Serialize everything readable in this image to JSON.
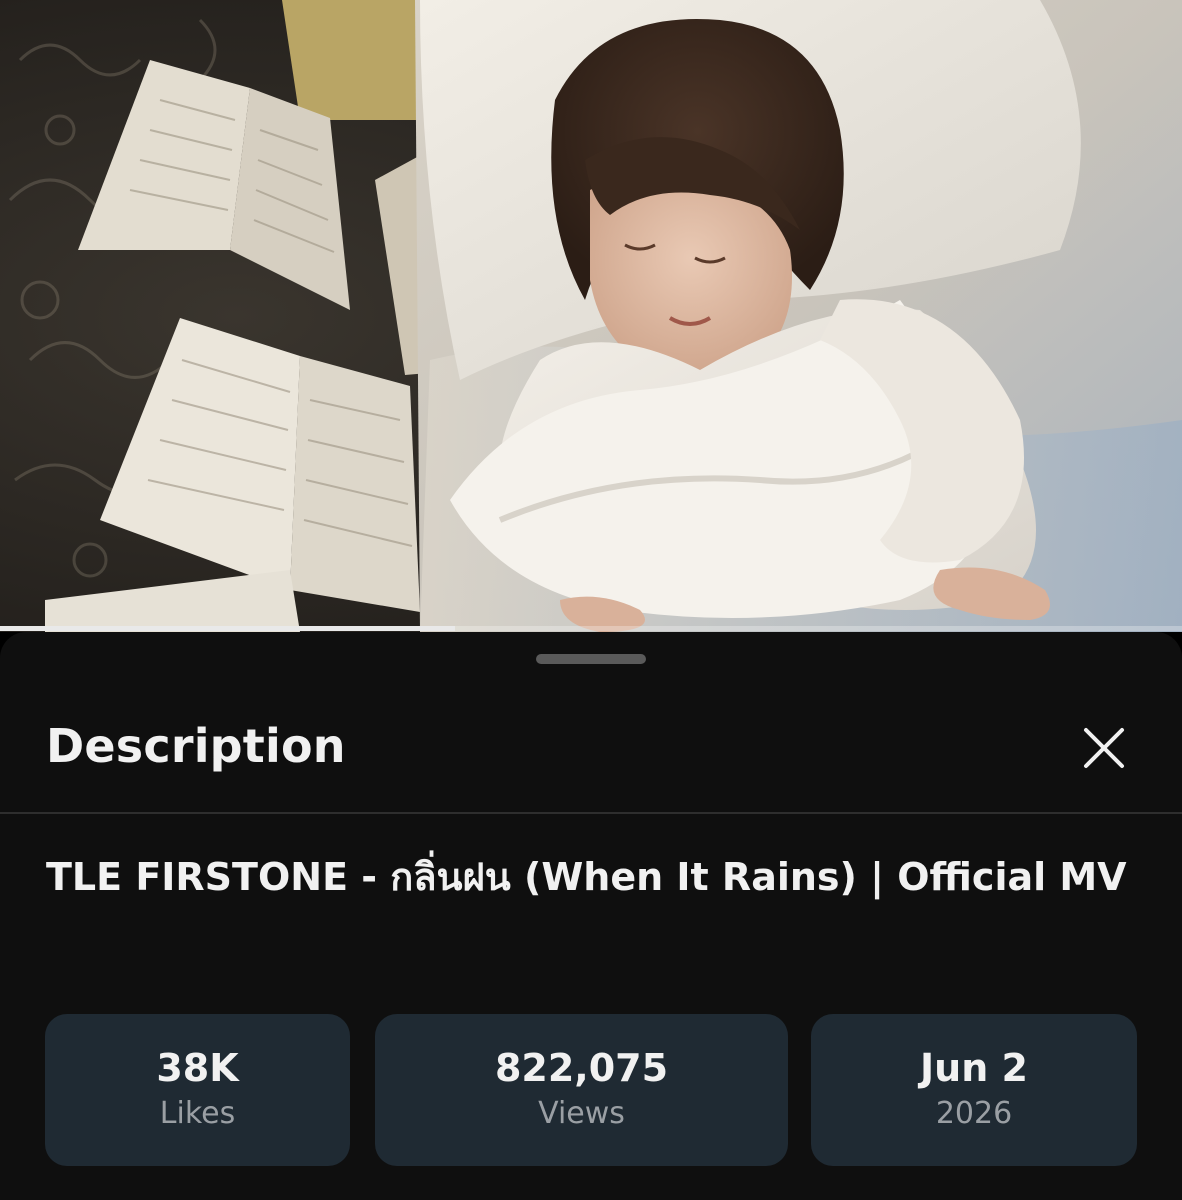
{
  "video": {
    "progress_fraction": 0.385
  },
  "sheet": {
    "title": "Description",
    "close_icon": "close-icon"
  },
  "video_info": {
    "title": "TLE FIRSTONE - กลิ่นฝน (When It Rains) | Official MV"
  },
  "stats": {
    "likes": {
      "value": "38K",
      "label": "Likes"
    },
    "views": {
      "value": "822,075",
      "label": "Views"
    },
    "date": {
      "value": "Jun 2",
      "label": "2026"
    }
  },
  "colors": {
    "sheet_background": "#0f0f0f",
    "stat_card": "#1f2a33",
    "primary_text": "#f1f1f1",
    "secondary_text": "#9a9fa4"
  }
}
